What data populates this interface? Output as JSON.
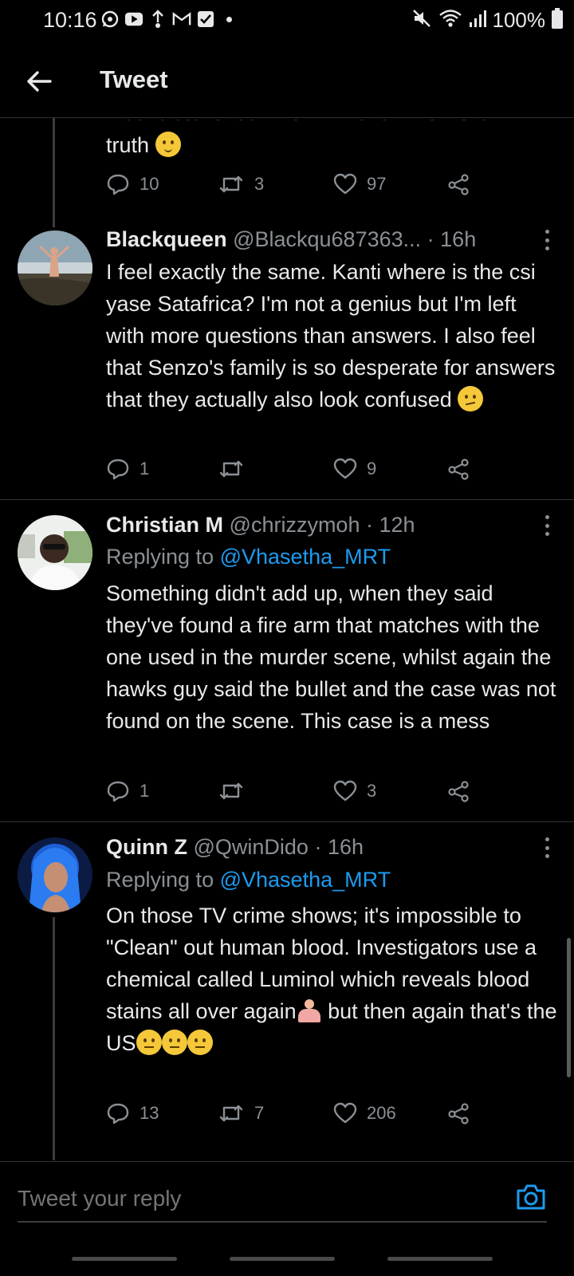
{
  "status_bar": {
    "time": "10:16",
    "battery": "100%"
  },
  "header": {
    "title": "Tweet"
  },
  "tweets": [
    {
      "cut_text": "inconsistent lies. We will never know the",
      "text": "truth",
      "emoji": "relieved-face",
      "replies": "10",
      "retweets": "3",
      "likes": "97"
    },
    {
      "name": "Blackqueen",
      "handle": "@Blackqu687363...",
      "time": "· 16h",
      "text": "I feel exactly the same. Kanti where is the csi yase Satafrica? I'm not a genius but I'm left with more questions than answers. I also feel that Senzo's family is so desperate for answers that they actually also look confused",
      "emoji": "confused-face",
      "replies": "1",
      "retweets": "",
      "likes": "9"
    },
    {
      "name": "Christian M",
      "handle": "@chrizzymoh",
      "time": "· 12h",
      "replying_label": "Replying to",
      "replying_to": "@Vhasetha_MRT",
      "text": "Something didn't add up, when they said they've found a fire arm that matches with the one used in the murder scene, whilst again the hawks guy said the bullet and the case was not found on the scene. This case is a mess",
      "replies": "1",
      "retweets": "",
      "likes": "3"
    },
    {
      "name": "Quinn Z",
      "handle": "@QwinDido",
      "time": "· 16h",
      "replying_label": "Replying to",
      "replying_to": "@Vhasetha_MRT",
      "text_a": "On those TV crime shows; it's impossible to \"Clean\" out human blood. Investigators use a chemical called Luminol which reveals blood stains all over again",
      "text_b": " but then again that's the US",
      "replies": "13",
      "retweets": "7",
      "likes": "206"
    }
  ],
  "compose": {
    "placeholder": "Tweet your reply"
  },
  "icons": [
    "whatsapp-icon",
    "youtube-icon",
    "upload-icon",
    "gmail-icon",
    "checkbox-icon",
    "mute-icon",
    "wifi-icon",
    "signal-icon",
    "battery-icon",
    "back-arrow-icon",
    "reply-icon",
    "retweet-icon",
    "like-icon",
    "share-icon",
    "more-icon",
    "camera-icon"
  ],
  "colors": {
    "background": "#000000",
    "text": "#e7e9ea",
    "secondary": "#8b9095",
    "accent": "#1d9bf0",
    "divider": "#2f3336"
  }
}
